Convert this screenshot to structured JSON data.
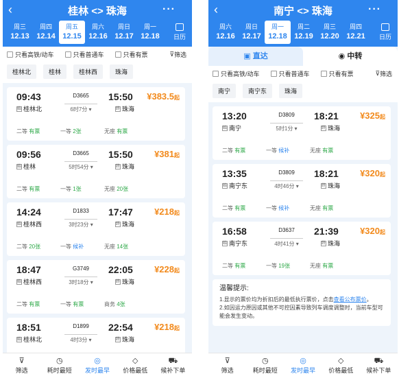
{
  "left": {
    "title": "桂林 <> 珠海",
    "dates": [
      {
        "day": "周三",
        "date": "12.13"
      },
      {
        "day": "周四",
        "date": "12.14"
      },
      {
        "day": "周五",
        "date": "12.15",
        "selected": true
      },
      {
        "day": "周六",
        "date": "12.16"
      },
      {
        "day": "周日",
        "date": "12.17"
      },
      {
        "day": "周一",
        "date": "12.18"
      }
    ],
    "calendar": "日历",
    "filters": [
      "只看高铁/动车",
      "只看普通车",
      "只看有票"
    ],
    "filter_btn": "筛选",
    "stations": [
      "桂林北",
      "桂林",
      "桂林西",
      "珠海"
    ],
    "trains": [
      {
        "dep": "09:43",
        "train": "D3665",
        "dur": "6时7分",
        "arr": "15:50",
        "dst": "桂林北",
        "ast": "珠海",
        "price": "383.5",
        "s1": "二等",
        "s1v": "有票",
        "s2": "一等",
        "s2v": "2张",
        "s3": "无座",
        "s3v": "有票"
      },
      {
        "dep": "09:56",
        "train": "D3665",
        "dur": "5时54分",
        "arr": "15:50",
        "dst": "桂林",
        "ast": "珠海",
        "price": "381",
        "s1": "二等",
        "s1v": "有票",
        "s2": "一等",
        "s2v": "1张",
        "s3": "无座",
        "s3v": "20张"
      },
      {
        "dep": "14:24",
        "train": "D1833",
        "dur": "3时23分",
        "arr": "17:47",
        "dst": "桂林西",
        "ast": "珠海",
        "price": "218",
        "s1": "二等",
        "s1v": "20张",
        "s2": "一等",
        "s2v": "候补",
        "s3": "无座",
        "s3v": "14张"
      },
      {
        "dep": "18:47",
        "train": "G3749",
        "dur": "3时18分",
        "arr": "22:05",
        "dst": "桂林西",
        "ast": "珠海",
        "price": "228",
        "s1": "二等",
        "s1v": "有票",
        "s2": "一等",
        "s2v": "有票",
        "s3": "商务",
        "s3v": "4张"
      },
      {
        "dep": "18:51",
        "train": "D1899",
        "dur": "4时3分",
        "arr": "22:54",
        "dst": "桂林北",
        "ast": "珠海",
        "price": "218",
        "s1": "",
        "s1v": "",
        "s2": "",
        "s2v": "",
        "s3": "",
        "s3v": ""
      }
    ],
    "price_suffix": "起"
  },
  "right": {
    "title": "南宁 <> 珠海",
    "dates": [
      {
        "day": "周六",
        "date": "12.16"
      },
      {
        "day": "周日",
        "date": "12.17"
      },
      {
        "day": "周一",
        "date": "12.18",
        "selected": true
      },
      {
        "day": "周二",
        "date": "12.19"
      },
      {
        "day": "周三",
        "date": "12.20"
      },
      {
        "day": "周四",
        "date": "12.21"
      }
    ],
    "calendar": "日历",
    "tabs": [
      "直达",
      "中转"
    ],
    "filters": [
      "只看高铁/动车",
      "只看普通车",
      "只看有票"
    ],
    "filter_btn": "筛选",
    "stations": [
      "南宁",
      "南宁东",
      "珠海"
    ],
    "trains": [
      {
        "dep": "13:20",
        "train": "D3809",
        "dur": "5时1分",
        "arr": "18:21",
        "dst": "南宁",
        "ast": "珠海",
        "price": "325",
        "s1": "二等",
        "s1v": "有票",
        "s2": "一等",
        "s2v": "候补",
        "s3": "无座",
        "s3v": "有票"
      },
      {
        "dep": "13:35",
        "train": "D3809",
        "dur": "4时46分",
        "arr": "18:21",
        "dst": "南宁东",
        "ast": "珠海",
        "price": "320",
        "s1": "二等",
        "s1v": "有票",
        "s2": "一等",
        "s2v": "候补",
        "s3": "无座",
        "s3v": "有票"
      },
      {
        "dep": "16:58",
        "train": "D3637",
        "dur": "4时41分",
        "arr": "21:39",
        "dst": "南宁东",
        "ast": "珠海",
        "price": "320",
        "s1": "二等",
        "s1v": "有票",
        "s2": "一等",
        "s2v": "19张",
        "s3": "无座",
        "s3v": "有票"
      }
    ],
    "tip_title": "温馨提示:",
    "tip1": "1.显示的票价均为折扣后的最低执行票价，点击",
    "tip1_link": "查看公布票价",
    "tip2": "2.如因运力原因或其他不可控因素导致列车调度调整时，当前车型可能会发生变动。",
    "price_suffix": "起"
  },
  "bottom": [
    "筛选",
    "耗时最短",
    "发时最早",
    "价格最低",
    "候补下单"
  ]
}
